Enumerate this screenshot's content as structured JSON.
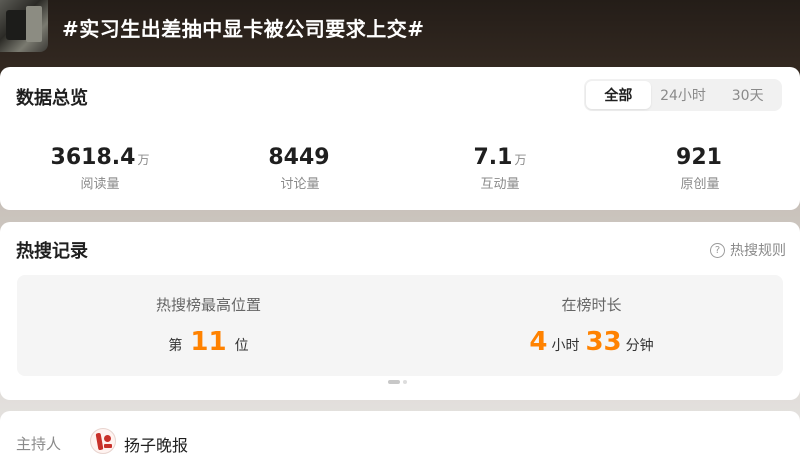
{
  "header": {
    "topic_title": "#实习生出差抽中显卡被公司要求上交#"
  },
  "overview": {
    "title": "数据总览",
    "tabs": [
      {
        "label": "全部",
        "active": true
      },
      {
        "label": "24小时",
        "active": false
      },
      {
        "label": "30天",
        "active": false
      }
    ],
    "stats": [
      {
        "value": "3618.4",
        "unit": "万",
        "label": "阅读量"
      },
      {
        "value": "8449",
        "unit": "",
        "label": "讨论量"
      },
      {
        "value": "7.1",
        "unit": "万",
        "label": "互动量"
      },
      {
        "value": "921",
        "unit": "",
        "label": "原创量"
      }
    ]
  },
  "hot_search": {
    "title": "热搜记录",
    "rules_link": "热搜规则",
    "highest_position": {
      "label": "热搜榜最高位置",
      "prefix": "第",
      "value": "11",
      "suffix": "位"
    },
    "duration": {
      "label": "在榜时长",
      "hours": "4",
      "hours_unit": "小时",
      "minutes": "33",
      "minutes_unit": "分钟"
    }
  },
  "host": {
    "label": "主持人",
    "name": "扬子晚报"
  },
  "colors": {
    "accent": "#ff8200",
    "muted_text": "#8a8a8a",
    "card_bg": "#ffffff",
    "panel_bg": "#f5f5f5"
  }
}
